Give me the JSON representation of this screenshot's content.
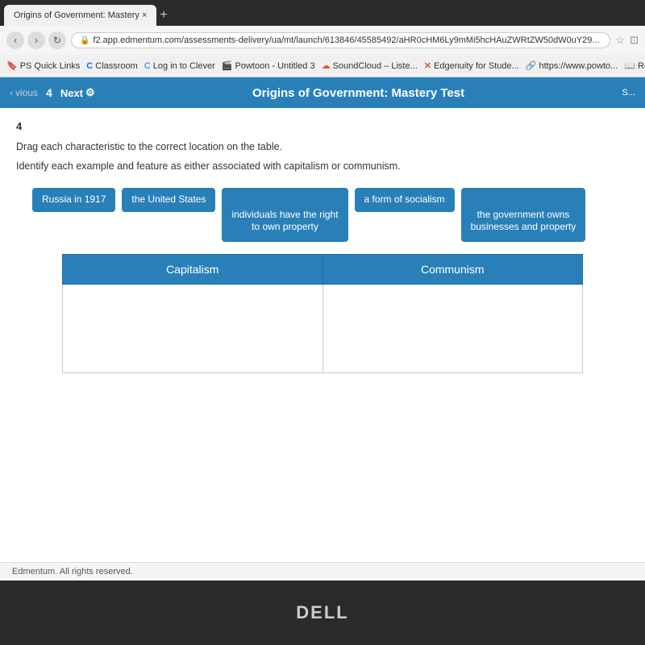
{
  "browser": {
    "tab_title": "Origins of Government: Mastery  ×",
    "tab_new": "+",
    "url": "f2.app.edmentum.com/assessments-delivery/ua/mt/launch/613846/45585492/aHR0cHM6Ly9mMi5hcHAuZWRtZW50dW0uY29...",
    "bookmarks": [
      {
        "label": "PS Quick Links",
        "icon_color": "#555"
      },
      {
        "label": "Classroom",
        "icon_color": "#1a73e8"
      },
      {
        "label": "Log in to Clever",
        "icon_color": "#1a73e8"
      },
      {
        "label": "Powtoon - Untitled 3",
        "icon_color": "#e74c3c"
      },
      {
        "label": "SoundCloud – Liste...",
        "icon_color": "#e74c3c"
      },
      {
        "label": "Edgenuity for Stude...",
        "icon_color": "#e74c3c"
      },
      {
        "label": "https://www.powto...",
        "icon_color": "#34a853"
      },
      {
        "label": "Reading Plus | Ada...",
        "icon_color": "#2980b9"
      }
    ]
  },
  "toolbar": {
    "previous_label": "vious",
    "question_number": "4",
    "next_label": "Next",
    "next_icon": "⚙",
    "title": "Origins of Government: Mastery Test",
    "save_label": "S..."
  },
  "question": {
    "number": "4",
    "instructions_1": "Drag each characteristic to the correct location on the table.",
    "instructions_2": "Identify each example and feature as either associated with capitalism or communism.",
    "drag_items": [
      {
        "id": "item1",
        "label": "Russia in 1917"
      },
      {
        "id": "item2",
        "label": "the United States"
      },
      {
        "id": "item3",
        "label": "individuals have the right\nto own property"
      },
      {
        "id": "item4",
        "label": "a form of socialism"
      },
      {
        "id": "item5",
        "label": "the government owns\nbusinesses and property"
      }
    ],
    "table": {
      "col1_header": "Capitalism",
      "col2_header": "Communism"
    }
  },
  "footer": {
    "text": "Edmentum. All rights reserved."
  },
  "laptop": {
    "brand": "DELL"
  }
}
